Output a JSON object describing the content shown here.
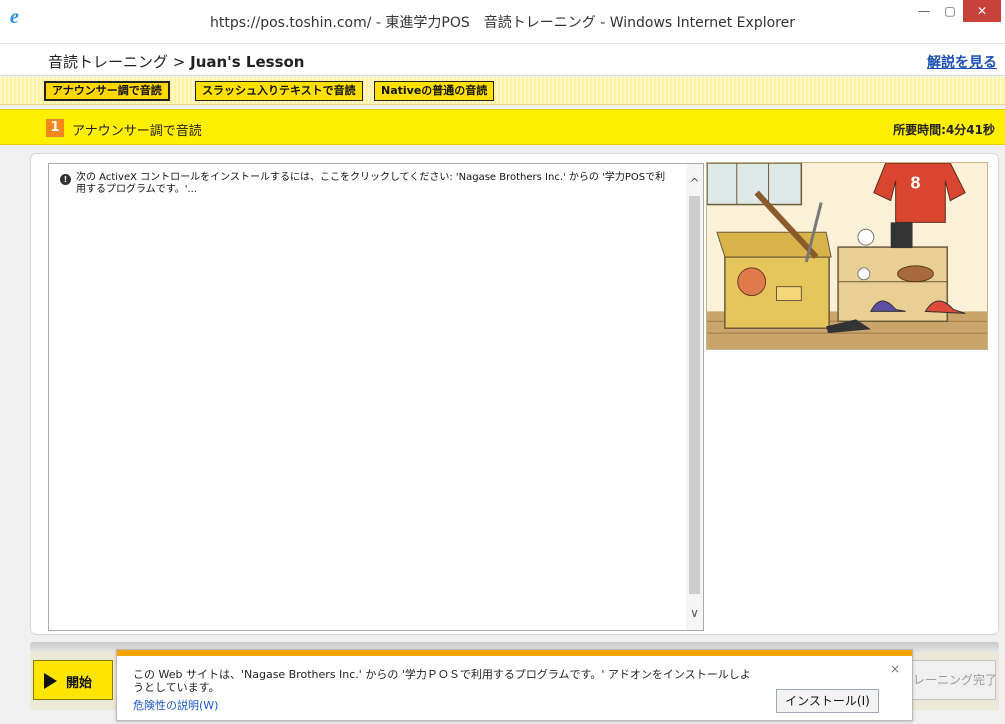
{
  "window": {
    "title": "https://pos.toshin.com/ - 東進学力POS　音読トレーニング - Windows Internet Explorer",
    "minimize_glyph": "—",
    "maximize_glyph": "▢",
    "close_glyph": "✕"
  },
  "header": {
    "breadcrumb_prefix": "音読トレーニング > ",
    "breadcrumb_lesson": "Juan's Lesson",
    "explain_link": "解説を見る"
  },
  "tabs": [
    {
      "label": "アナウンサー調で音読",
      "active": true
    },
    {
      "label": "スラッシュ入りテキストで音読",
      "active": false
    },
    {
      "label": "Nativeの普通の音読",
      "active": false
    }
  ],
  "section": {
    "number": "1",
    "title": "アナウンサー調で音読",
    "time": "所要時間:4分41秒"
  },
  "content": {
    "activex_message": "次の ActiveX コントロールをインストールするには、ここをクリックしてください: 'Nagase Brothers Inc.' からの '学力POSで利用するプログラムです。'...",
    "shield_icon": "shield-icon"
  },
  "scrollbar": {
    "up_glyph": "^",
    "down_glyph": "∨"
  },
  "controls": {
    "start_label": "開始",
    "finish_label": "トレーニング完了"
  },
  "notification": {
    "message": "この Web サイトは、'Nagase Brothers Inc.' からの '学力ＰＯＳで利用するプログラムです。' アドオンをインストールしようとしています。",
    "risk_link": "危険性の説明(W)",
    "install_button": "インストール(I)",
    "close_glyph": "×"
  },
  "colors": {
    "accent_yellow": "#ffef00",
    "section_number_bg": "#f5861f",
    "notification_accent": "#f3a400",
    "link_blue": "#1a4fb4"
  }
}
